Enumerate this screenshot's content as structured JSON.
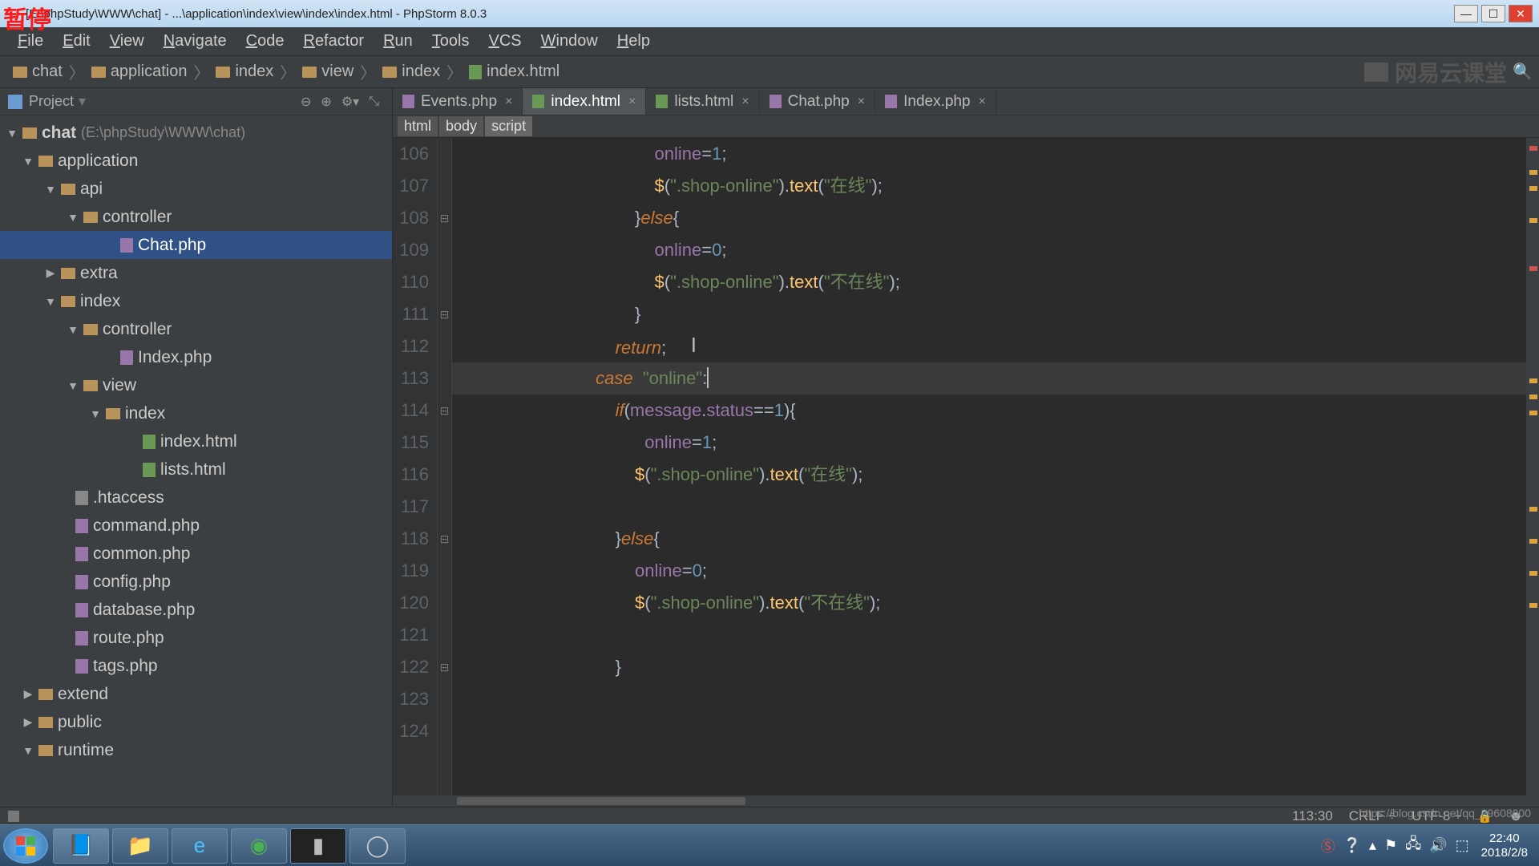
{
  "pause_overlay": "暂停",
  "title": "[E:\\phpStudy\\WWW\\chat] - ...\\application\\index\\view\\index\\index.html - PhpStorm 8.0.3",
  "menu": [
    "File",
    "Edit",
    "View",
    "Navigate",
    "Code",
    "Refactor",
    "Run",
    "Tools",
    "VCS",
    "Window",
    "Help"
  ],
  "breadcrumb": [
    "chat",
    "application",
    "index",
    "view",
    "index",
    "index.html"
  ],
  "watermark": "网易云课堂",
  "project": {
    "title": "Project",
    "root": "chat",
    "root_hint": "(E:\\phpStudy\\WWW\\chat)",
    "nodes": [
      {
        "pad": 28,
        "arr": "▼",
        "ic": "fic2",
        "label": "application",
        "bold": false
      },
      {
        "pad": 56,
        "arr": "▼",
        "ic": "fic2",
        "label": "api"
      },
      {
        "pad": 84,
        "arr": "▼",
        "ic": "fic2",
        "label": "controller"
      },
      {
        "pad": 130,
        "arr": "",
        "ic": "phic",
        "label": "Chat.php",
        "sel": true
      },
      {
        "pad": 56,
        "arr": "▶",
        "ic": "fic2",
        "label": "extra"
      },
      {
        "pad": 56,
        "arr": "▼",
        "ic": "fic2",
        "label": "index"
      },
      {
        "pad": 84,
        "arr": "▼",
        "ic": "fic2",
        "label": "controller"
      },
      {
        "pad": 130,
        "arr": "",
        "ic": "phic",
        "label": "Index.php"
      },
      {
        "pad": 84,
        "arr": "▼",
        "ic": "fic2",
        "label": "view"
      },
      {
        "pad": 112,
        "arr": "▼",
        "ic": "fic2",
        "label": "index"
      },
      {
        "pad": 158,
        "arr": "",
        "ic": "hic2",
        "label": "index.html"
      },
      {
        "pad": 158,
        "arr": "",
        "ic": "hic2",
        "label": "lists.html"
      },
      {
        "pad": 74,
        "arr": "",
        "ic": "gic",
        "label": ".htaccess"
      },
      {
        "pad": 74,
        "arr": "",
        "ic": "phic",
        "label": "command.php"
      },
      {
        "pad": 74,
        "arr": "",
        "ic": "phic",
        "label": "common.php"
      },
      {
        "pad": 74,
        "arr": "",
        "ic": "phic",
        "label": "config.php"
      },
      {
        "pad": 74,
        "arr": "",
        "ic": "phic",
        "label": "database.php"
      },
      {
        "pad": 74,
        "arr": "",
        "ic": "phic",
        "label": "route.php"
      },
      {
        "pad": 74,
        "arr": "",
        "ic": "phic",
        "label": "tags.php"
      },
      {
        "pad": 28,
        "arr": "▶",
        "ic": "fic2",
        "label": "extend"
      },
      {
        "pad": 28,
        "arr": "▶",
        "ic": "fic2",
        "label": "public"
      },
      {
        "pad": 28,
        "arr": "▼",
        "ic": "fic2",
        "label": "runtime"
      }
    ]
  },
  "tabs": [
    {
      "ic": "php",
      "label": "Events.php"
    },
    {
      "ic": "html",
      "label": "index.html",
      "active": true
    },
    {
      "ic": "html",
      "label": "lists.html"
    },
    {
      "ic": "php",
      "label": "Chat.php"
    },
    {
      "ic": "php",
      "label": "Index.php"
    }
  ],
  "editor_crumbs": [
    "html",
    "body",
    "script"
  ],
  "lines": [
    "106",
    "107",
    "108",
    "109",
    "110",
    "111",
    "112",
    "113",
    "114",
    "115",
    "116",
    "117",
    "118",
    "119",
    "120",
    "121",
    "122",
    "123",
    "124"
  ],
  "code_tokens": {
    "online": "online",
    "eq": "=",
    "one": "1",
    "zero": "0",
    "semi": ";",
    "jq": "$",
    "lp": "(",
    "rp": ")",
    "dot": ".",
    "sel_shop": "\".shop-online\"",
    "text": "text",
    "txt_on": "\"在线\"",
    "txt_off": "\"不在线\"",
    "lb": "{",
    "rb": "}",
    "else": "else",
    "return": "return",
    "case": "case ",
    "case_val": "\"online\"",
    "colon": ":",
    "if": "if",
    "msg": "message",
    "status": "status",
    "eqeq": "=="
  },
  "status": {
    "pos": "113:30",
    "sep": "CRLF ÷",
    "enc": "UTF-8 ÷"
  },
  "tray": {
    "time": "22:40",
    "date": "2018/2/8"
  },
  "csdn_url": "https://blog.csdn.net/qq_29608000"
}
